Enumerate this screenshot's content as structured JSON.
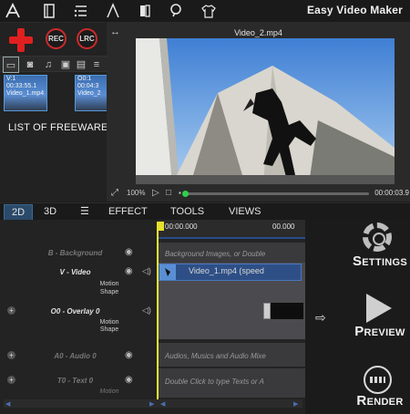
{
  "app": {
    "title": "Easy Video Maker"
  },
  "toolbar": {
    "icons": [
      "logo-icon",
      "book-icon",
      "settings-list-icon",
      "text-a-icon",
      "clip-icon",
      "search-icon",
      "tshirt-icon"
    ]
  },
  "media": {
    "rec_label": "REC",
    "lrc_label": "LRC",
    "clips": [
      {
        "line1": "V:1",
        "line2": "00:33:55.1",
        "line3": "Video_1.mp4"
      },
      {
        "line1": "O0:1",
        "line2": "00:04:3",
        "line3": "Video_2"
      }
    ],
    "caption": "LIST OF FREEWARE"
  },
  "preview": {
    "title": "Video_2.mp4",
    "zoom": "100%",
    "timecode": "00:00:03.9"
  },
  "tabs": {
    "t2d": "2D",
    "t3d": "3D",
    "effect": "EFFECT",
    "tools": "TOOLS",
    "views": "VIEWS"
  },
  "timeline": {
    "ruler_start": "00:00.000",
    "ruler_end": "00.000",
    "tracks": {
      "background": {
        "label": "B - Background",
        "hint": "Background Images, or Double"
      },
      "video": {
        "label": "V - Video",
        "sub1": "Motion",
        "sub2": "Shape",
        "clip": "Video_1.mp4  (speed"
      },
      "overlay": {
        "label": "O0 - Overlay 0",
        "sub1": "Motion",
        "sub2": "Shape"
      },
      "audio": {
        "label": "A0 - Audio 0",
        "hint": "Audios, Musics and Audio Mixe"
      },
      "text": {
        "label": "T0 - Text 0",
        "sub1": "Motion",
        "hint": "Double Click to type Texts or A"
      }
    }
  },
  "side": {
    "settings": {
      "cap": "S",
      "rest": "ETTINGS"
    },
    "preview": {
      "cap": "P",
      "rest": "REVIEW"
    },
    "render": {
      "cap": "R",
      "rest": "ENDER"
    }
  },
  "colors": {
    "accent_red": "#e02020",
    "playhead": "#f5f034",
    "clip_blue": "#2e4f86"
  }
}
